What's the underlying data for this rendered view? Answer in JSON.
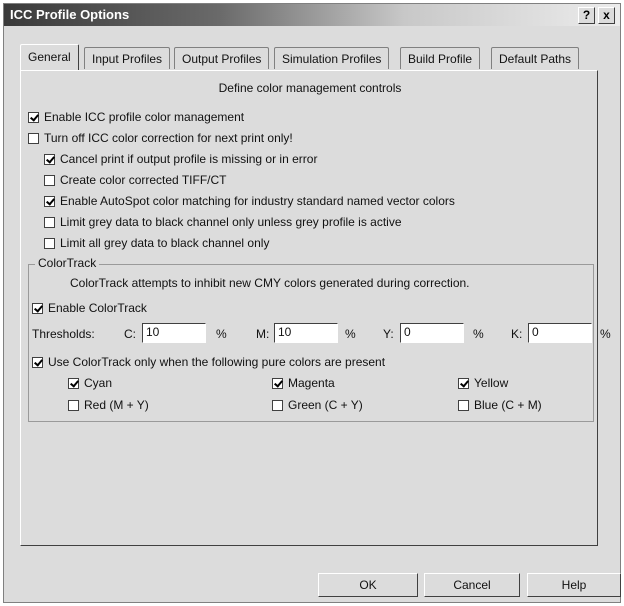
{
  "window": {
    "title": "ICC Profile Options",
    "help_button": "?",
    "close_button": "x"
  },
  "tabs": [
    "General",
    "Input Profiles",
    "Output Profiles",
    "Simulation Profiles",
    "Build Profile",
    "Default Paths"
  ],
  "panel": {
    "description": "Define color management controls",
    "options": [
      {
        "label": "Enable ICC profile color management",
        "checked": true
      },
      {
        "label": "Turn off ICC color correction for next print only!",
        "checked": false
      },
      {
        "label": "Cancel print if output profile is missing or in error",
        "checked": true
      },
      {
        "label": "Create color corrected TIFF/CT",
        "checked": false
      },
      {
        "label": "Enable AutoSpot color matching for industry standard named vector colors",
        "checked": true
      },
      {
        "label": "Limit grey data to black channel only unless grey profile is active",
        "checked": false
      },
      {
        "label": "Limit all grey data to black channel only",
        "checked": false
      }
    ],
    "colortrack": {
      "group_label": "ColorTrack",
      "description": "ColorTrack attempts to inhibit new CMY colors generated during correction.",
      "enable": {
        "label": "Enable ColorTrack",
        "checked": true
      },
      "thresholds_label": "Thresholds:",
      "thresholds": [
        {
          "label": "C:",
          "value": "10",
          "unit": "%"
        },
        {
          "label": "M:",
          "value": "10",
          "unit": "%"
        },
        {
          "label": "Y:",
          "value": "0",
          "unit": "%"
        },
        {
          "label": "K:",
          "value": "0",
          "unit": "%"
        }
      ],
      "use_only": {
        "label": "Use ColorTrack only when the following pure colors are present",
        "checked": true
      },
      "colors": [
        {
          "label": "Cyan",
          "checked": true
        },
        {
          "label": "Magenta",
          "checked": true
        },
        {
          "label": "Yellow",
          "checked": true
        },
        {
          "label": "Red (M + Y)",
          "checked": false
        },
        {
          "label": "Green (C + Y)",
          "checked": false
        },
        {
          "label": "Blue (C + M)",
          "checked": false
        }
      ]
    }
  },
  "buttons": {
    "ok": "OK",
    "cancel": "Cancel",
    "help": "Help"
  }
}
